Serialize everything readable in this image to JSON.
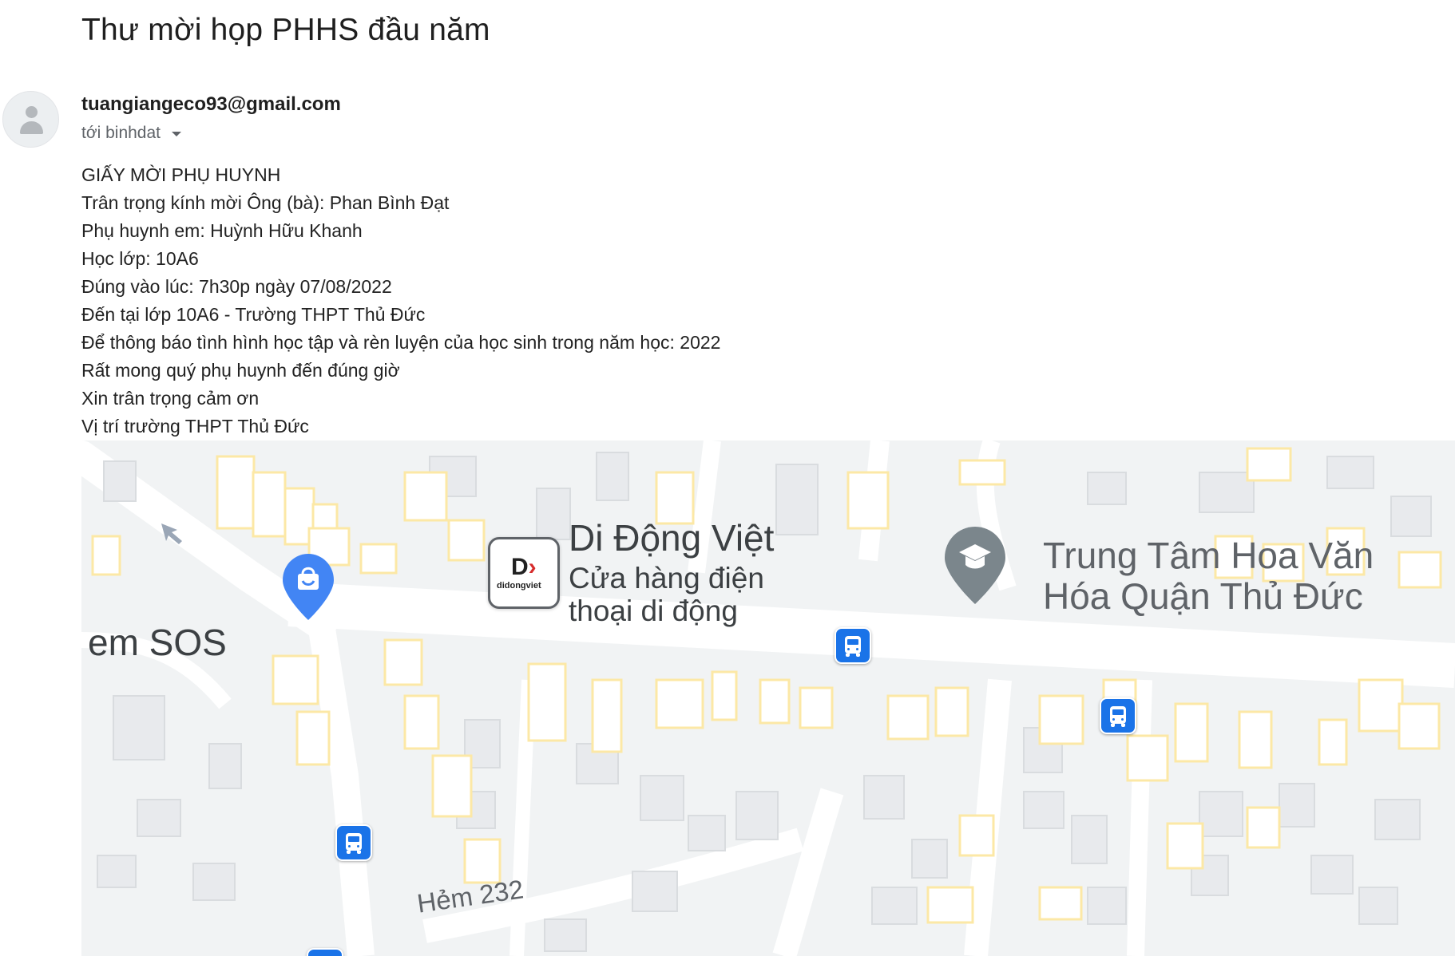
{
  "email": {
    "subject": "Thư mời họp PHHS đầu năm",
    "sender": "tuangiangeco93@gmail.com",
    "recipient_line": "tới binhdat",
    "body_lines": [
      "GIẤY MỜI PHỤ HUYNH",
      "Trân trọng kính mời Ông (bà): Phan Bình Đạt",
      "Phụ huynh em: Huỳnh Hữu Khanh",
      "Học lớp: 10A6",
      "Đúng vào lúc: 7h30p ngày 07/08/2022",
      "Đến tại lớp 10A6 - Trường THPT Thủ Đức",
      "Để thông báo tình hình học tập và rèn luyện của học sinh trong năm học: 2022",
      "Rất mong quý phụ huynh đến đúng giờ",
      "Xin trân trọng cảm ơn",
      "Vị trí trường THPT Thủ Đức"
    ]
  },
  "map": {
    "place_store_name": "Di Động Việt",
    "place_store_desc_1": "Cửa hàng điện",
    "place_store_desc_2": "thoại di động",
    "store_logo_brand": "didongviet",
    "place_edu_line_1": "Trung Tâm Hoa Văn",
    "place_edu_line_2": "Hóa Quận Thủ Đức",
    "label_left": "em SOS",
    "road_label": "Hẻm 232",
    "icons": [
      "shopping-bag-pin-icon",
      "education-pin-icon",
      "bus-stop-icon",
      "direction-arrow-icon"
    ],
    "colors": {
      "building_outline": "#fce8a6",
      "building_fill": "#e8eaed",
      "road": "#ffffff",
      "land": "#f1f3f4",
      "bus_stop": "#1a73e8",
      "shop_pin": "#4285f4",
      "edu_pin": "#7b868c"
    }
  }
}
